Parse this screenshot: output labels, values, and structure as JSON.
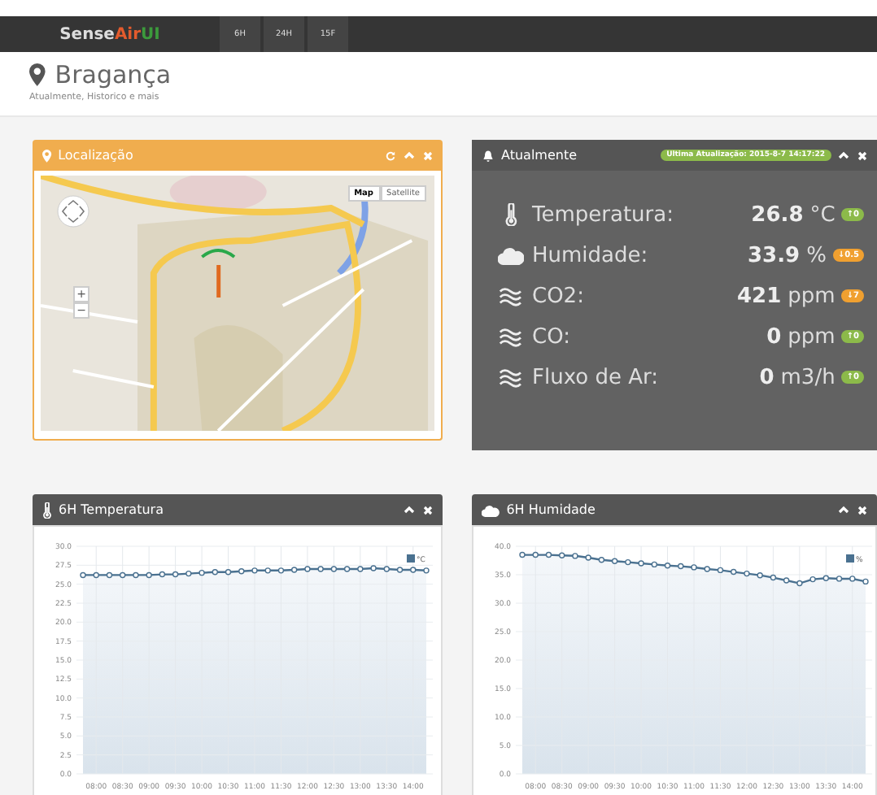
{
  "navbar": {
    "logo": [
      "Sense",
      "Air",
      "UI"
    ],
    "tabs": [
      {
        "label": "6H",
        "selected": false
      },
      {
        "label": "24H",
        "selected": false
      },
      {
        "label": "15F",
        "selected": false
      }
    ]
  },
  "header": {
    "title": "Bragança",
    "subtitle": "Atualmente, Historico e mais"
  },
  "location_panel": {
    "title": "Localização",
    "map": {
      "kind": "picture",
      "map_types": [
        {
          "label": "Map",
          "selected": true
        },
        {
          "label": "Satellite",
          "selected": false
        }
      ],
      "zoom": [
        "+",
        "−"
      ]
    }
  },
  "current_panel": {
    "title": "Atualmente",
    "badge": "Ultima Atualização: 2015-8-7 14:17:22",
    "rows": [
      {
        "kind": "thermometer",
        "label": "Temperatura:",
        "value": "26.8",
        "unit": "°C",
        "change": "↑0",
        "color": "#8cba4a"
      },
      {
        "kind": "cloud",
        "label": "Humidade:",
        "value": "33.9",
        "unit": "%",
        "change": "↓0.5",
        "color": "#f0a030"
      },
      {
        "kind": "waves",
        "label": "CO2:",
        "value": "421",
        "unit": "ppm",
        "change": "↓7",
        "color": "#f0a030"
      },
      {
        "kind": "waves",
        "label": "CO:",
        "value": "0",
        "unit": "ppm",
        "change": "↑0",
        "color": "#8cba4a"
      },
      {
        "kind": "waves",
        "label": "Fluxo de Ar:",
        "value": "0",
        "unit": "m3/h",
        "change": "↑0",
        "color": "#8cba4a"
      }
    ]
  },
  "charts": [
    {
      "title": "6H Temperatura",
      "kind": "thermometer",
      "chart_data": {
        "type": "line",
        "x": [
          465,
          480,
          495,
          510,
          525,
          540,
          555,
          570,
          585,
          600,
          615,
          630,
          645,
          660,
          675,
          690,
          705,
          720,
          735,
          750,
          765,
          780,
          795,
          810,
          825,
          840,
          855
        ],
        "series": [
          {
            "name": "°C",
            "color": "#4a7190",
            "marker": "circle",
            "values": [
              26.2,
              26.2,
              26.2,
              26.2,
              26.2,
              26.2,
              26.3,
              26.3,
              26.4,
              26.5,
              26.6,
              26.6,
              26.7,
              26.8,
              26.8,
              26.8,
              26.9,
              27.0,
              27.0,
              27.0,
              27.0,
              27.0,
              27.1,
              27.0,
              26.9,
              26.9,
              26.8
            ]
          }
        ],
        "grid": true,
        "ylim": [
          0,
          30
        ],
        "yticks": [
          {
            "value": 0,
            "label": "0.0"
          },
          {
            "value": 2.5,
            "label": "2.5"
          },
          {
            "value": 5,
            "label": "5.0"
          },
          {
            "value": 7.5,
            "label": "7.5"
          },
          {
            "value": 10,
            "label": "10.0"
          },
          {
            "value": 12.5,
            "label": "12.5"
          },
          {
            "value": 15,
            "label": "15.0"
          },
          {
            "value": 17.5,
            "label": "17.5"
          },
          {
            "value": 20,
            "label": "20.0"
          },
          {
            "value": 22.5,
            "label": "22.5"
          },
          {
            "value": 25,
            "label": "25.0"
          },
          {
            "value": 27.5,
            "label": "27.5"
          },
          {
            "value": 30,
            "label": "30.0"
          }
        ],
        "xlim": [
          465,
          855
        ],
        "xticks": [
          {
            "value": 480,
            "label": "08:00"
          },
          {
            "value": 510,
            "label": "08:30"
          },
          {
            "value": 540,
            "label": "09:00"
          },
          {
            "value": 570,
            "label": "09:30"
          },
          {
            "value": 600,
            "label": "10:00"
          },
          {
            "value": 630,
            "label": "10:30"
          },
          {
            "value": 660,
            "label": "11:00"
          },
          {
            "value": 690,
            "label": "11:30"
          },
          {
            "value": 720,
            "label": "12:00"
          },
          {
            "value": 750,
            "label": "12:30"
          },
          {
            "value": 780,
            "label": "13:00"
          },
          {
            "value": 810,
            "label": "13:30"
          },
          {
            "value": 840,
            "label": "14:00"
          }
        ]
      }
    },
    {
      "title": "6H Humidade",
      "kind": "cloud",
      "chart_data": {
        "type": "line",
        "x": [
          465,
          480,
          495,
          510,
          525,
          540,
          555,
          570,
          585,
          600,
          615,
          630,
          645,
          660,
          675,
          690,
          705,
          720,
          735,
          750,
          765,
          780,
          795,
          810,
          825,
          840,
          855
        ],
        "series": [
          {
            "name": "%",
            "color": "#4a7190",
            "marker": "circle",
            "values": [
              38.5,
              38.5,
              38.5,
              38.4,
              38.3,
              38.0,
              37.6,
              37.4,
              37.2,
              37.0,
              36.8,
              36.6,
              36.5,
              36.3,
              36.0,
              35.8,
              35.5,
              35.2,
              34.9,
              34.5,
              34.0,
              33.5,
              34.2,
              34.4,
              34.3,
              34.3,
              33.8
            ]
          }
        ],
        "grid": true,
        "ylim": [
          0,
          40
        ],
        "yticks": [
          {
            "value": 0,
            "label": "0.0"
          },
          {
            "value": 5,
            "label": "5.0"
          },
          {
            "value": 10,
            "label": "10.0"
          },
          {
            "value": 15,
            "label": "15.0"
          },
          {
            "value": 20,
            "label": "20.0"
          },
          {
            "value": 25,
            "label": "25.0"
          },
          {
            "value": 30,
            "label": "30.0"
          },
          {
            "value": 35,
            "label": "35.0"
          },
          {
            "value": 40,
            "label": "40.0"
          }
        ],
        "xlim": [
          465,
          855
        ],
        "xticks": [
          {
            "value": 480,
            "label": "08:00"
          },
          {
            "value": 510,
            "label": "08:30"
          },
          {
            "value": 540,
            "label": "09:00"
          },
          {
            "value": 570,
            "label": "09:30"
          },
          {
            "value": 600,
            "label": "10:00"
          },
          {
            "value": 630,
            "label": "10:30"
          },
          {
            "value": 660,
            "label": "11:00"
          },
          {
            "value": 690,
            "label": "11:30"
          },
          {
            "value": 720,
            "label": "12:00"
          },
          {
            "value": 750,
            "label": "12:30"
          },
          {
            "value": 780,
            "label": "13:00"
          },
          {
            "value": 810,
            "label": "13:30"
          },
          {
            "value": 840,
            "label": "14:00"
          }
        ]
      }
    }
  ]
}
